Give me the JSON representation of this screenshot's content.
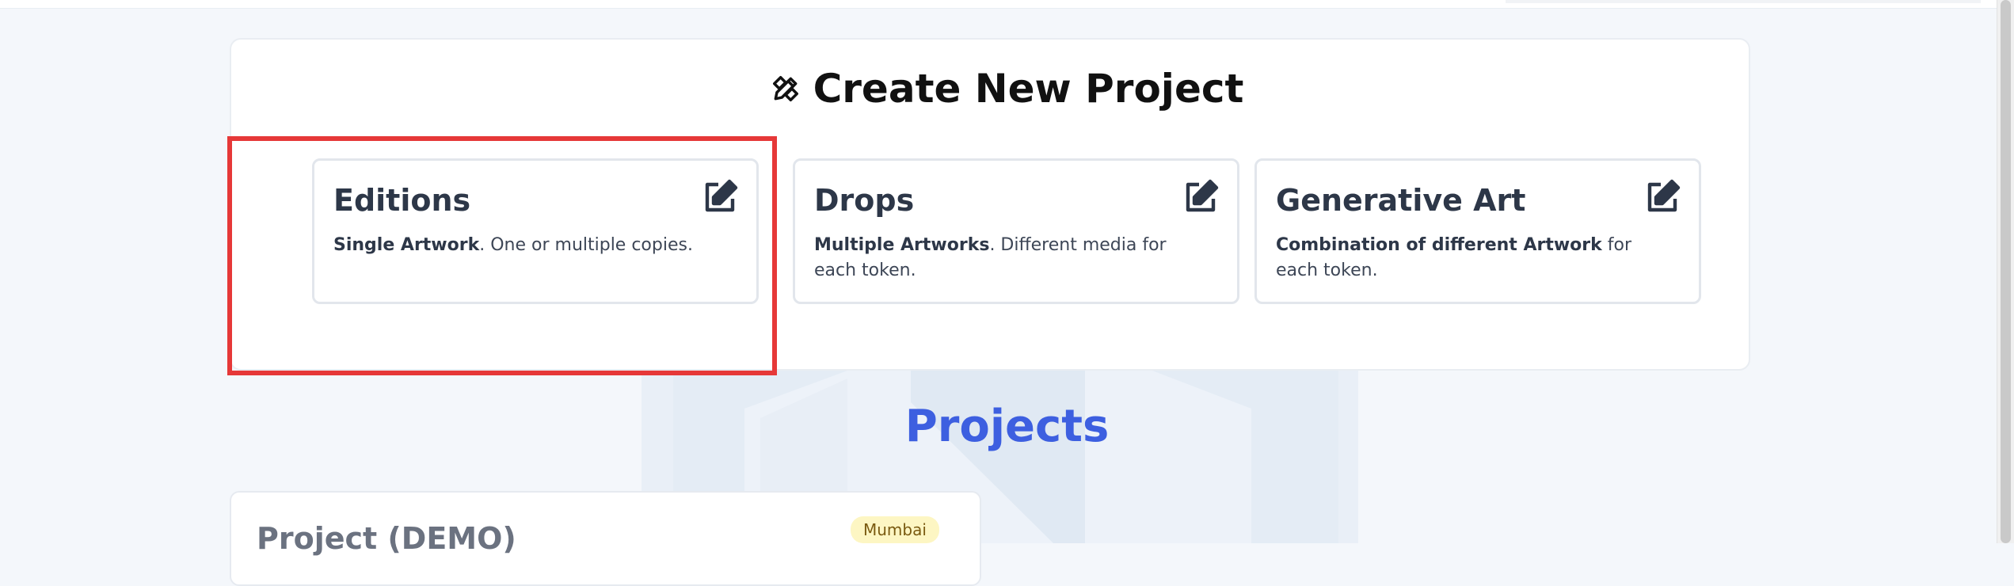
{
  "create_section": {
    "title": "Create New Project",
    "title_icon": "pencil-ruler-icon",
    "types": [
      {
        "title": "Editions",
        "desc_bold": "Single Artwork",
        "desc_rest": ". One or multiple copies.",
        "icon": "edit-icon"
      },
      {
        "title": "Drops",
        "desc_bold": "Multiple Artworks",
        "desc_rest": ". Different media for each token.",
        "icon": "edit-icon"
      },
      {
        "title": "Generative Art",
        "desc_bold": "Combination of different Artwork",
        "desc_rest": " for each token.",
        "icon": "edit-icon"
      }
    ]
  },
  "projects_section": {
    "title": "Projects",
    "items": [
      {
        "name": "Project (DEMO)",
        "network": "Mumbai"
      }
    ]
  },
  "colors": {
    "accent": "#3d5fe0",
    "highlight": "#e63838",
    "badge_bg": "#fdf6c3"
  }
}
